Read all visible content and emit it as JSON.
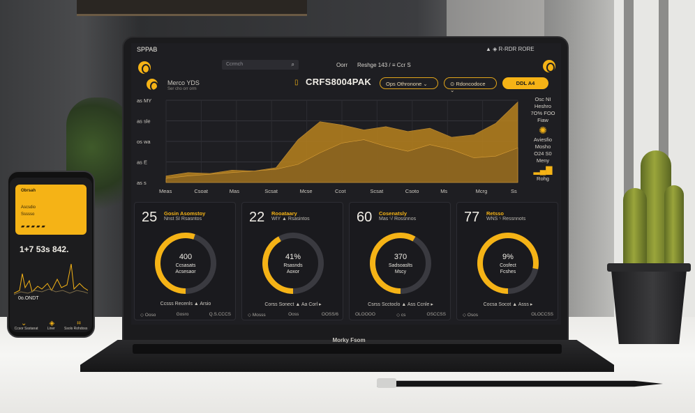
{
  "topbar": {
    "app_name": "SPPAB",
    "search_placeholder": "Ccrmch",
    "nav1": "Oorr",
    "nav2": "Reshge 143 / ≡ Ccr S",
    "status_right": "R-RDR RORE"
  },
  "header": {
    "user_line1": "Merco YDS",
    "user_line2": "Ser cho orr orm",
    "chart_title": "CRFS8004PAK",
    "pill1": "Ops Othronone",
    "pill2": "Rdoncodoce",
    "pill3": "DDL A4"
  },
  "chart_data": {
    "type": "area",
    "y_ticks": [
      "as MY",
      "as sle",
      "os wa",
      "as E",
      "as s"
    ],
    "categories": [
      "Meas",
      "Csoat",
      "Mas",
      "Scsat",
      "Mcse",
      "Ccot",
      "Scsat",
      "Csoto",
      "Ms",
      "Mcrg",
      "Ss"
    ],
    "series": [
      {
        "values": [
          8,
          12,
          11,
          15,
          14,
          18,
          52,
          74,
          70,
          64,
          68,
          62,
          66,
          55,
          58,
          72,
          98
        ]
      },
      {
        "values": [
          5,
          8,
          10,
          12,
          14,
          16,
          22,
          36,
          48,
          52,
          44,
          38,
          46,
          40,
          30,
          32,
          42
        ]
      }
    ],
    "ylim": [
      0,
      100
    ],
    "colors": [
      "#b8821e",
      "#8a6420"
    ]
  },
  "side_stats": {
    "s1": "Osc NI",
    "s2": "Heshro",
    "s3": "7O% FOO",
    "s4": "Fiaw",
    "s5": "Aviesfio",
    "s6": "Mosho",
    "s7": "O24 S0",
    "s8": "Meny",
    "s9": "Rohg"
  },
  "cards": [
    {
      "big": "25",
      "t1": "Gosin Asomstoy",
      "t2": "Nnst SI   Rsasntos",
      "ring_val": "400",
      "ring_sub1": "Ccsasats",
      "ring_sub2": "Acsesaor",
      "pct": 0.55,
      "foot1": "Ccsss Recenls   ▲ Arsio",
      "foot2a": "◇ Ooso",
      "foot2b": "Gosro",
      "foot2c": "Q.S.CCCS"
    },
    {
      "big": "22",
      "t1": "Rooataary",
      "t2": "WIY ▲   Rsasintos",
      "ring_val": "41%",
      "ring_sub1": "Rsasnds",
      "ring_sub2": "Aoxor",
      "pct": 0.42,
      "foot1": "Corss Sonect   ▲ Aa Corl ▸",
      "foot2a": "◇ Mosss",
      "foot2b": "Ooss",
      "foot2c": "OOSS/6"
    },
    {
      "big": "60",
      "t1": "Cosenatsly",
      "t2": "Mas ⁵/ Rossnnos",
      "ring_val": "370",
      "ring_sub1": "Sadsoaslts",
      "ring_sub2": "Mscy",
      "pct": 0.58,
      "foot1": "Csrss Scctoclo   ▲ Ass Ccnle ▸",
      "foot2a": "OLOOOO",
      "foot2b": "◇ cs",
      "foot2c": "OSCCSS"
    },
    {
      "big": "77",
      "t1": "Retsso",
      "t2": "WNS ⁵   Ressnnots",
      "ring_val": "9%",
      "ring_sub1": "Cosfect",
      "ring_sub2": "Fcshes",
      "pct": 0.78,
      "foot1": "Cocsa Socot   ▲ Asss ▸",
      "foot2a": "◇ Osos",
      "foot2b": "",
      "foot2c": "OLOCCSS"
    }
  ],
  "phone": {
    "card_l1": "Obrsah",
    "card_l2": "Ascsdio",
    "card_l3": "Ssssso",
    "big": "1+7 53s 842.",
    "ondt": "0o.ONDT",
    "nav_labels": [
      "Ccsor Ssstanat",
      "Liner",
      "Ssols Rohdoss"
    ]
  },
  "laptop_brand": "Morky Fsom",
  "accent": "#f5b316"
}
